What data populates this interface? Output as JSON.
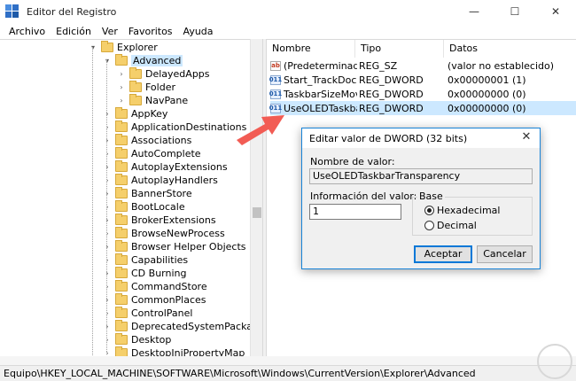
{
  "window": {
    "title": "Editor del Registro",
    "controls": [
      "—",
      "☐",
      "✕"
    ]
  },
  "menu": [
    "Archivo",
    "Edición",
    "Ver",
    "Favoritos",
    "Ayuda"
  ],
  "tree": {
    "items": [
      {
        "label": "Explorer",
        "indent": 0,
        "expander": "▾"
      },
      {
        "label": "Advanced",
        "indent": 1,
        "expander": "▾",
        "selected": true
      },
      {
        "label": "DelayedApps",
        "indent": 2,
        "expander": "›"
      },
      {
        "label": "Folder",
        "indent": 2,
        "expander": "›"
      },
      {
        "label": "NavPane",
        "indent": 2,
        "expander": "›"
      },
      {
        "label": "AppKey",
        "indent": 1,
        "expander": "›"
      },
      {
        "label": "ApplicationDestinations",
        "indent": 1,
        "expander": "›"
      },
      {
        "label": "Associations",
        "indent": 1,
        "expander": "›"
      },
      {
        "label": "AutoComplete",
        "indent": 1,
        "expander": "›"
      },
      {
        "label": "AutoplayExtensions",
        "indent": 1,
        "expander": "›"
      },
      {
        "label": "AutoplayHandlers",
        "indent": 1,
        "expander": "›"
      },
      {
        "label": "BannerStore",
        "indent": 1,
        "expander": "›"
      },
      {
        "label": "BootLocale",
        "indent": 1,
        "expander": "›"
      },
      {
        "label": "BrokerExtensions",
        "indent": 1,
        "expander": "›"
      },
      {
        "label": "BrowseNewProcess",
        "indent": 1,
        "expander": "›"
      },
      {
        "label": "Browser Helper Objects",
        "indent": 1,
        "expander": "›"
      },
      {
        "label": "Capabilities",
        "indent": 1,
        "expander": "›"
      },
      {
        "label": "CD Burning",
        "indent": 1,
        "expander": "›"
      },
      {
        "label": "CommandStore",
        "indent": 1,
        "expander": "›"
      },
      {
        "label": "CommonPlaces",
        "indent": 1,
        "expander": "›"
      },
      {
        "label": "ControlPanel",
        "indent": 1,
        "expander": "›"
      },
      {
        "label": "DeprecatedSystemPackages",
        "indent": 1,
        "expander": "›"
      },
      {
        "label": "Desktop",
        "indent": 1,
        "expander": "›"
      },
      {
        "label": "DesktopIniPropertyMap",
        "indent": 1,
        "expander": "›"
      }
    ]
  },
  "list": {
    "columns": [
      "Nombre",
      "Tipo",
      "Datos"
    ],
    "rows": [
      {
        "icon": "ab",
        "name": "(Predeterminado)",
        "type": "REG_SZ",
        "data": "(valor no establecido)"
      },
      {
        "icon": "011",
        "name": "Start_TrackDocs",
        "type": "REG_DWORD",
        "data": "0x00000001 (1)"
      },
      {
        "icon": "011",
        "name": "TaskbarSizeMove",
        "type": "REG_DWORD",
        "data": "0x00000000 (0)"
      },
      {
        "icon": "011",
        "name": "UseOLEDTaskba...",
        "type": "REG_DWORD",
        "data": "0x00000000 (0)",
        "selected": true
      }
    ]
  },
  "dialog": {
    "title": "Editar valor de DWORD (32 bits)",
    "close": "✕",
    "name_label": "Nombre de valor:",
    "name_value": "UseOLEDTaskbarTransparency",
    "data_label": "Información del valor:",
    "data_value": "1",
    "base_label": "Base",
    "base_options": [
      "Hexadecimal",
      "Decimal"
    ],
    "base_selected": "Hexadecimal",
    "ok_label": "Aceptar",
    "cancel_label": "Cancelar"
  },
  "status": {
    "path": "Equipo\\HKEY_LOCAL_MACHINE\\SOFTWARE\\Microsoft\\Windows\\CurrentVersion\\Explorer\\Advanced"
  },
  "colors": {
    "selection": "#cce8ff",
    "arrow": "#f25c54",
    "dialog_border": "#1883d7"
  }
}
